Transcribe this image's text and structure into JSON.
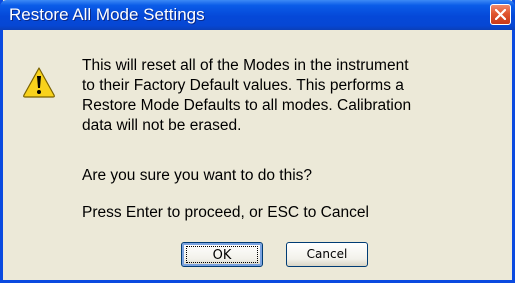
{
  "dialog": {
    "title": "Restore All Mode Settings",
    "message_lines": [
      "This will reset all of the Modes in the instrument",
      "to their Factory Default values.   This performs a",
      "Restore Mode Defaults to all modes.  Calibration",
      "data will not be erased."
    ],
    "question": "Are you sure you want to do this?",
    "instruction": "Press Enter to proceed, or ESC to Cancel",
    "ok_label": "OK",
    "cancel_label": "Cancel",
    "icon": "warning-icon",
    "close_icon": "close-icon"
  },
  "colors": {
    "titlebar": "#0548d8",
    "body": "#ece9d8",
    "close": "#e0552e",
    "warning": "#f8d21c"
  }
}
